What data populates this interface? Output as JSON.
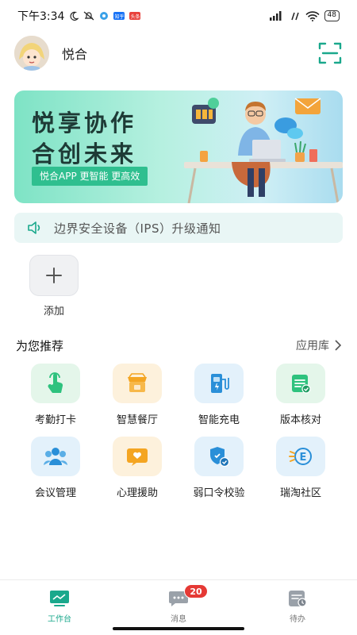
{
  "status_bar": {
    "time": "下午3:34",
    "battery": "48",
    "app_badges": [
      {
        "name": "zhihu",
        "text": "知乎",
        "color": "#1772f6"
      },
      {
        "name": "toutiao",
        "text": "头条",
        "color": "#e8413b"
      }
    ]
  },
  "header": {
    "user_name": "悦合"
  },
  "banner": {
    "title_line1": "悦享协作",
    "title_line2": "合创未来",
    "slogan": "悦合APP 更智能 更高效"
  },
  "notice": {
    "text": "边界安全设备（IPS）升级通知"
  },
  "add": {
    "label": "添加"
  },
  "recommend": {
    "title": "为您推荐",
    "more_label": "应用库",
    "apps": [
      {
        "label": "考勤打卡",
        "icon": "tap-icon",
        "bg": "#e4f6ea",
        "color": "#2ec27e"
      },
      {
        "label": "智慧餐厅",
        "icon": "restaurant-icon",
        "bg": "#fdf1dc",
        "color": "#f4a522"
      },
      {
        "label": "智能充电",
        "icon": "charging-icon",
        "bg": "#e3f1fb",
        "color": "#2a8fd8"
      },
      {
        "label": "版本核对",
        "icon": "checklist-icon",
        "bg": "#e4f6ea",
        "color": "#2ec27e"
      },
      {
        "label": "会议管理",
        "icon": "meeting-icon",
        "bg": "#e3f1fb",
        "color": "#2a8fd8"
      },
      {
        "label": "心理援助",
        "icon": "psychology-icon",
        "bg": "#fdf1dc",
        "color": "#f4a522"
      },
      {
        "label": "弱口令校验",
        "icon": "shield-check-icon",
        "bg": "#e3f1fb",
        "color": "#2a8fd8"
      },
      {
        "label": "瑞淘社区",
        "icon": "community-icon",
        "bg": "#e3f1fb",
        "color": "#2a8fd8"
      }
    ]
  },
  "bottom_nav": {
    "items": [
      {
        "label": "工作台",
        "icon": "workbench-icon",
        "active": true
      },
      {
        "label": "消息",
        "icon": "message-icon",
        "active": false
      },
      {
        "label": "待办",
        "icon": "todo-icon",
        "active": false
      }
    ],
    "message_badge": "20"
  },
  "colors": {
    "accent": "#1aa88c",
    "badge": "#e53935"
  }
}
